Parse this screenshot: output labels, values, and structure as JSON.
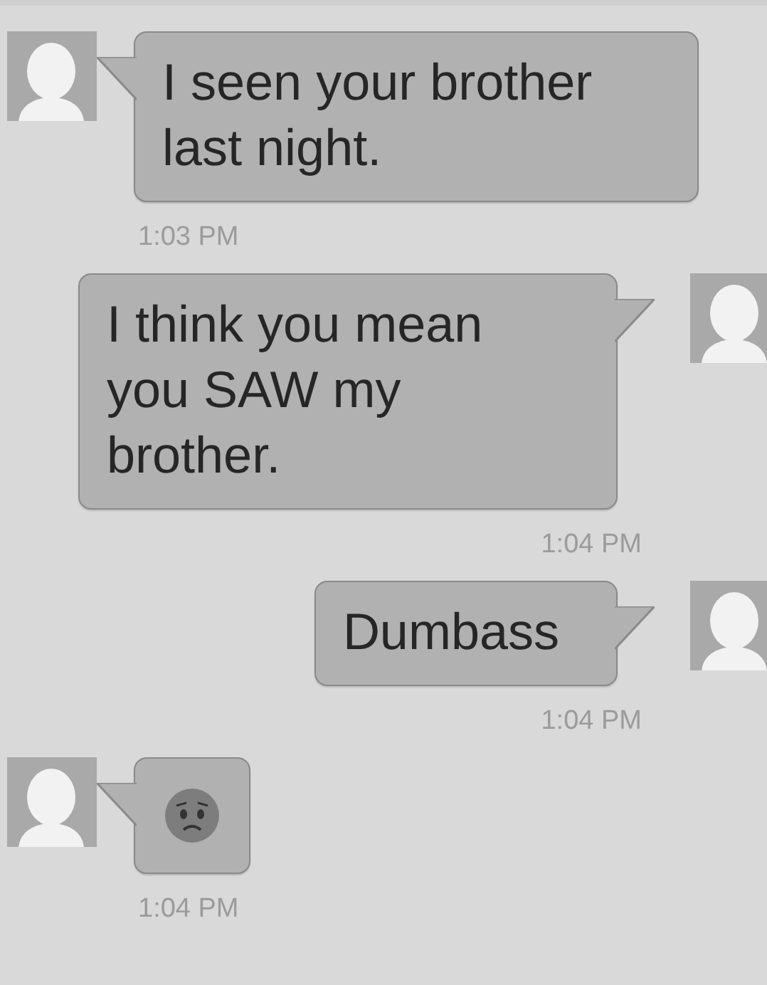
{
  "messages": [
    {
      "outgoing": false,
      "kind": "text",
      "text": "I seen your brother last night.",
      "time": "1:03 PM"
    },
    {
      "outgoing": true,
      "kind": "text",
      "text": "I think you mean you SAW my brother.",
      "time": "1:04 PM"
    },
    {
      "outgoing": true,
      "kind": "text",
      "text": "Dumbass",
      "time": "1:04 PM"
    },
    {
      "outgoing": false,
      "kind": "emoji",
      "time": "1:04 PM"
    }
  ]
}
